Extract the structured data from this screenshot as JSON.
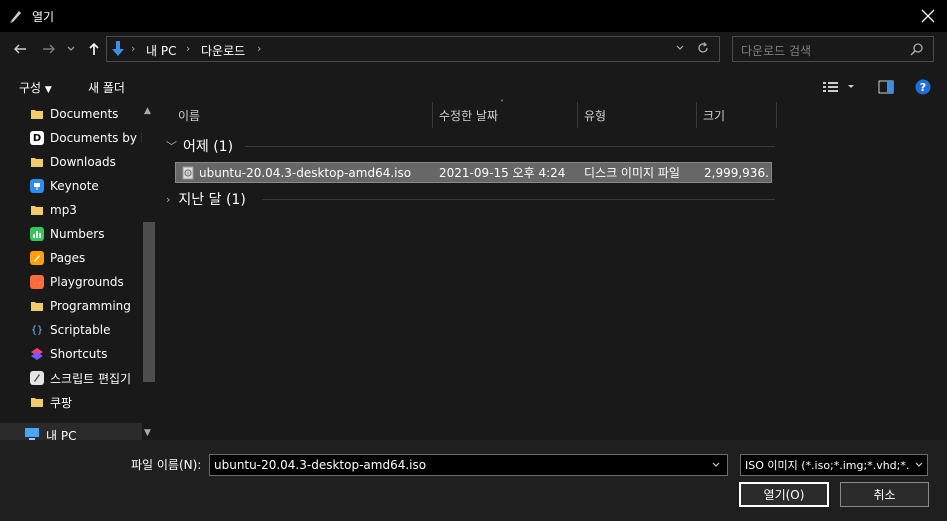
{
  "window": {
    "title": "열기"
  },
  "nav": {
    "path": [
      "내 PC",
      "다운로드"
    ],
    "search_placeholder": "다운로드 검색"
  },
  "toolbar": {
    "organize_label": "구성",
    "new_folder_label": "새 폴더"
  },
  "sidebar": {
    "items": [
      {
        "label": "Documents",
        "icon": "folder-icon",
        "color": "#f2cc6b"
      },
      {
        "label": "Documents by R",
        "icon": "d-app-icon",
        "color": "#ffffff"
      },
      {
        "label": "Downloads",
        "icon": "folder-icon",
        "color": "#f2cc6b"
      },
      {
        "label": "Keynote",
        "icon": "keynote-icon",
        "color": "#2d8cf0"
      },
      {
        "label": "mp3",
        "icon": "folder-icon",
        "color": "#f2cc6b"
      },
      {
        "label": "Numbers",
        "icon": "numbers-icon",
        "color": "#34c759"
      },
      {
        "label": "Pages",
        "icon": "pages-icon",
        "color": "#ff9f0a"
      },
      {
        "label": "Playgrounds",
        "icon": "swift-icon",
        "color": "#ff6a3d"
      },
      {
        "label": "Programming",
        "icon": "folder-icon",
        "color": "#f2cc6b"
      },
      {
        "label": "Scriptable",
        "icon": "code-icon",
        "color": "#191919"
      },
      {
        "label": "Shortcuts",
        "icon": "shortcuts-icon",
        "color": "#a855f7"
      },
      {
        "label": "스크립트 편집기",
        "icon": "script-editor-icon",
        "color": "#e5e5e5"
      },
      {
        "label": "쿠팡",
        "icon": "folder-icon",
        "color": "#f2cc6b"
      }
    ],
    "this_pc": "내 PC"
  },
  "columns": {
    "name": "이름",
    "modified": "수정한 날짜",
    "type": "유형",
    "size": "크기"
  },
  "groups": {
    "yesterday": "어제 (1)",
    "last_month": "지난 달 (1)"
  },
  "file": {
    "name": "ubuntu-20.04.3-desktop-amd64.iso",
    "modified": "2021-09-15 오후 4:24",
    "type": "디스크 이미지 파일",
    "size": "2,999,936..."
  },
  "footer": {
    "filename_label": "파일 이름(N):",
    "filename_value": "ubuntu-20.04.3-desktop-amd64.iso",
    "filter": "ISO 이미지 (*.iso;*.img;*.vhd;*.",
    "open_label": "열기(O)",
    "cancel_label": "취소"
  }
}
